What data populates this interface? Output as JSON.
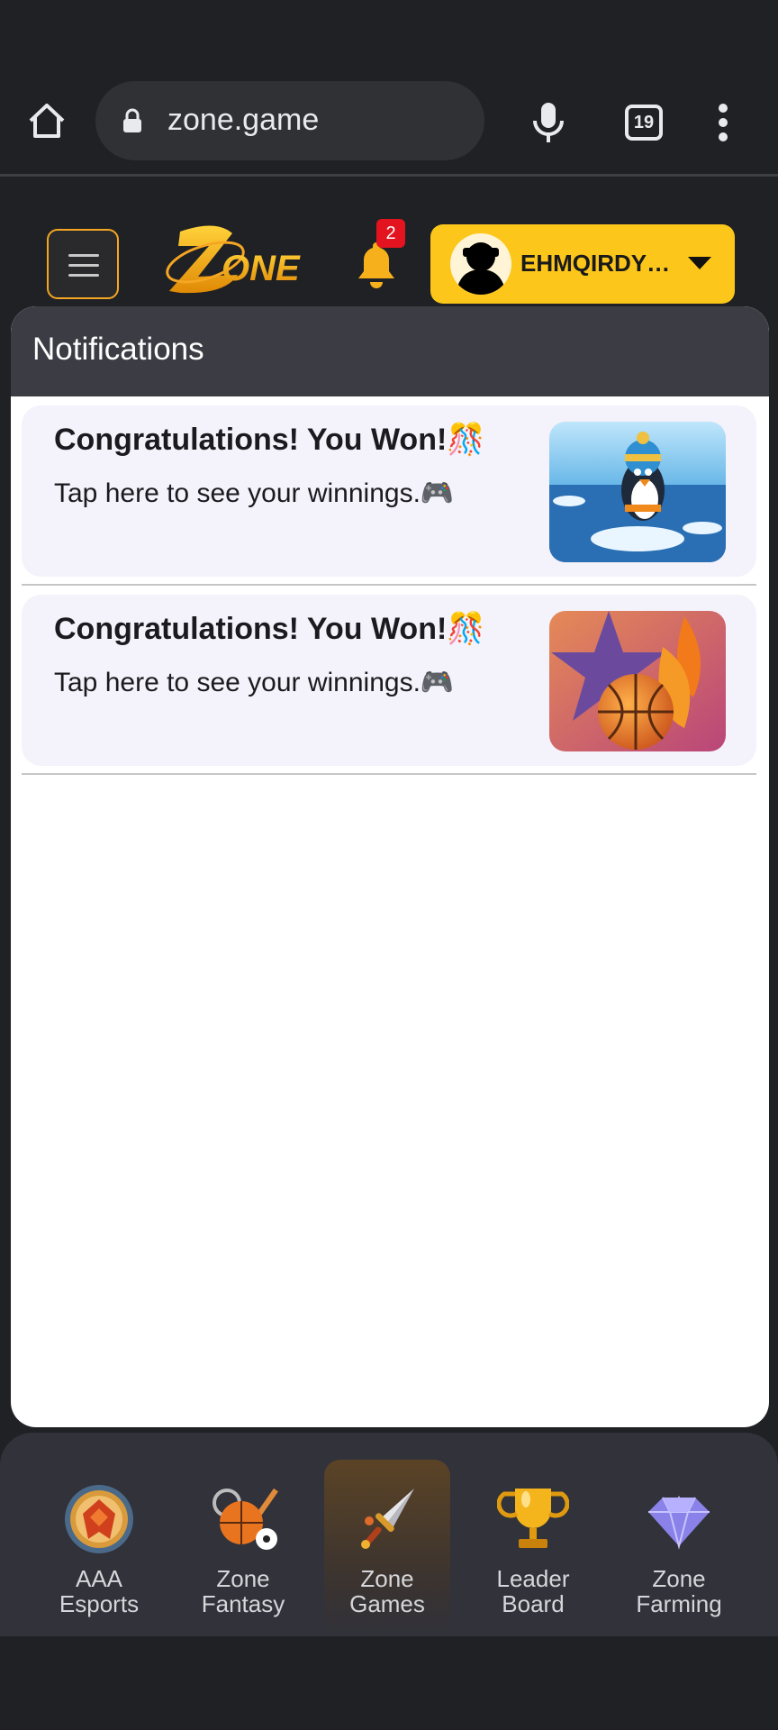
{
  "browser": {
    "url": "zone.game",
    "tab_count": "19",
    "icons": [
      "home-icon",
      "lock-icon",
      "microphone-icon",
      "tabs-icon",
      "more-vert-icon"
    ]
  },
  "header": {
    "notification_count": "2",
    "username": "EHMQIRDYZ...",
    "accent_color": "#fcc61b"
  },
  "notifications": {
    "title": "Notifications",
    "items": [
      {
        "title": "Congratulations! You Won!🎊",
        "body": "Tap here to see your winnings.🎮"
      },
      {
        "title": "Congratulations! You Won!🎊",
        "body": "Tap here to see your winnings.🎮"
      }
    ]
  },
  "bottom_nav": {
    "items": [
      {
        "line1": "AAA",
        "line2": "Esports"
      },
      {
        "line1": "Zone",
        "line2": "Fantasy"
      },
      {
        "line1": "Zone",
        "line2": "Games"
      },
      {
        "line1": "Leader",
        "line2": "Board"
      },
      {
        "line1": "Zone",
        "line2": "Farming"
      }
    ],
    "active_index": 2
  }
}
